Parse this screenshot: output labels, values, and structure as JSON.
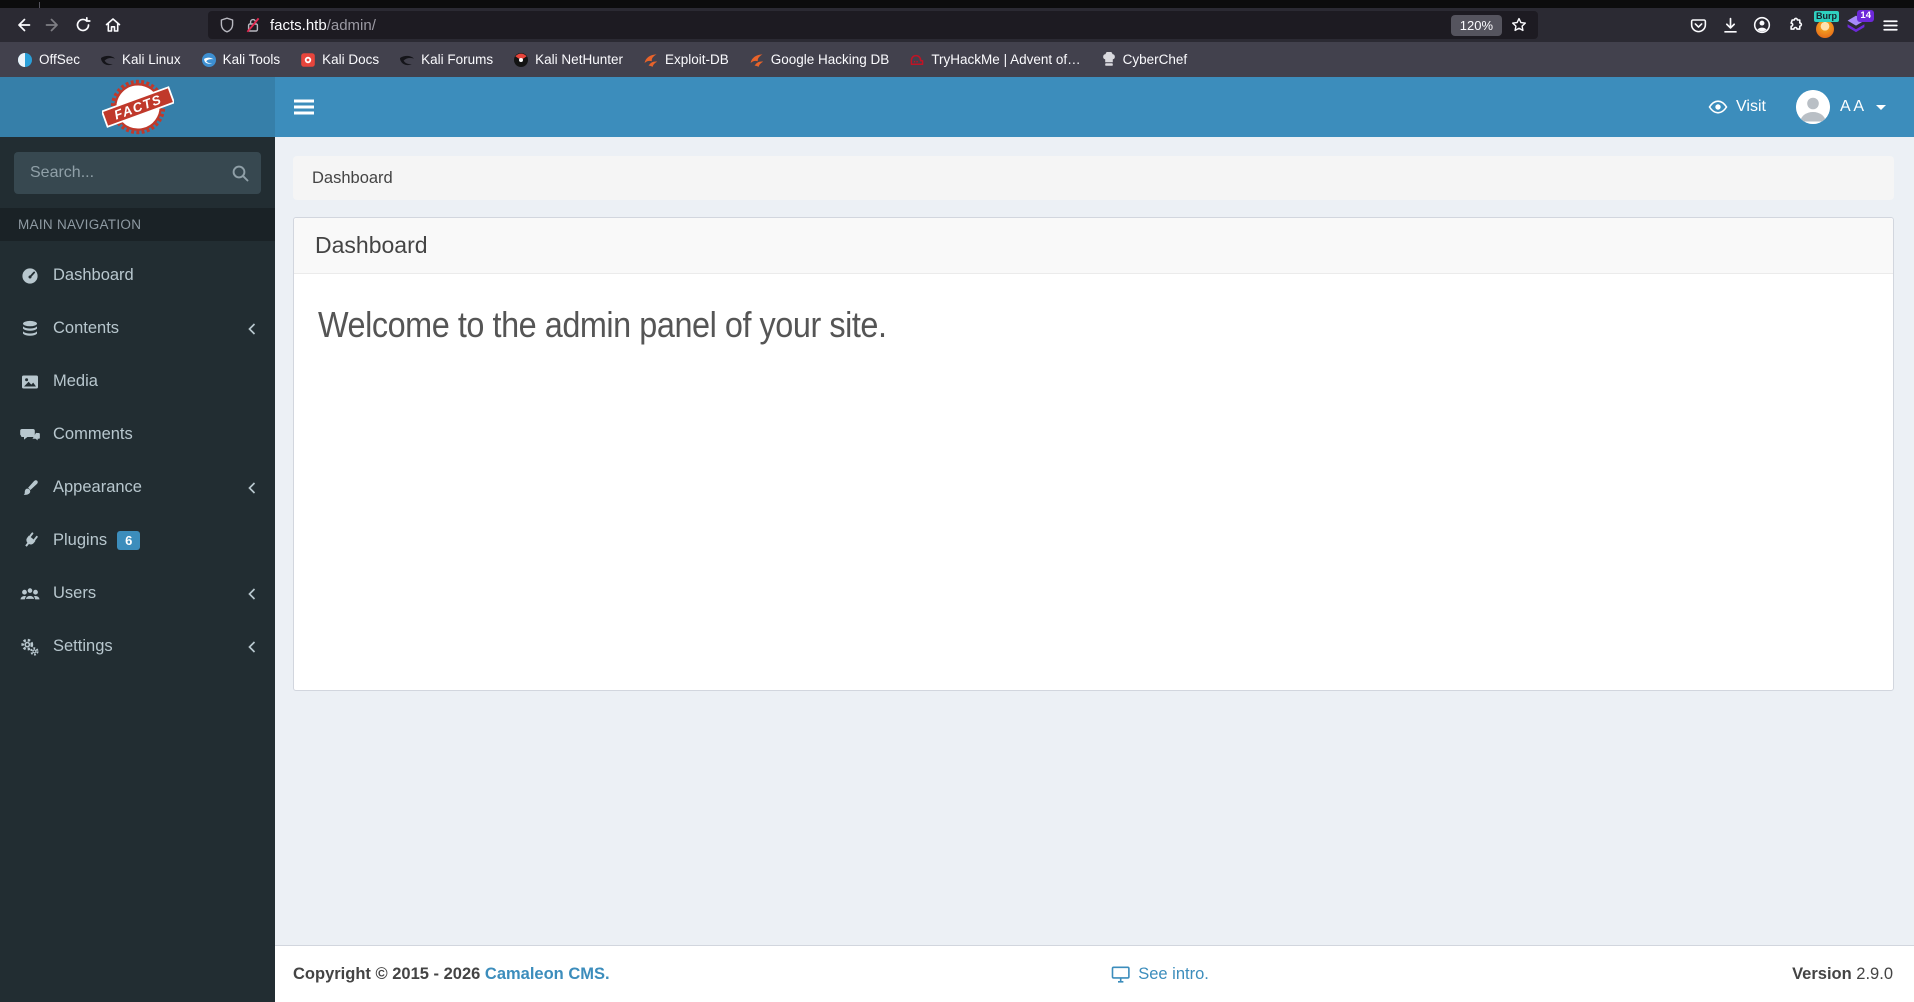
{
  "browser": {
    "url": {
      "host": "facts.htb",
      "path": "/admin/"
    },
    "zoom_badge": "120%",
    "proxy_label": "Burp",
    "extension_badge": "14",
    "bookmarks": [
      {
        "label": "OffSec"
      },
      {
        "label": "Kali Linux"
      },
      {
        "label": "Kali Tools"
      },
      {
        "label": "Kali Docs"
      },
      {
        "label": "Kali Forums"
      },
      {
        "label": "Kali NetHunter"
      },
      {
        "label": "Exploit-DB"
      },
      {
        "label": "Google Hacking DB"
      },
      {
        "label": "TryHackMe | Advent of…"
      },
      {
        "label": "CyberChef"
      }
    ]
  },
  "navbar": {
    "logo_text": "FACTS",
    "visit_label": "Visit",
    "user_initials": "A A"
  },
  "sidebar": {
    "search_placeholder": "Search...",
    "section_label": "MAIN NAVIGATION",
    "items": [
      {
        "label": "Dashboard"
      },
      {
        "label": "Contents",
        "chevron": true
      },
      {
        "label": "Media"
      },
      {
        "label": "Comments"
      },
      {
        "label": "Appearance",
        "chevron": true
      },
      {
        "label": "Plugins",
        "badge": "6"
      },
      {
        "label": "Users",
        "chevron": true
      },
      {
        "label": "Settings",
        "chevron": true
      }
    ]
  },
  "main": {
    "breadcrumb": "Dashboard",
    "panel_title": "Dashboard",
    "welcome_text": "Welcome to the admin panel of your site."
  },
  "footer": {
    "copyright": "Copyright © 2015 - 2026",
    "cms_link": "Camaleon CMS.",
    "see_intro": "See intro.",
    "version_label": "Version",
    "version_value": "2.9.0"
  },
  "icons": {
    "toolbar": [
      "back-icon",
      "forward-icon",
      "reload-icon",
      "home-icon",
      "shield-icon",
      "insecure-lock-icon",
      "star-icon",
      "pocket-icon",
      "downloads-icon",
      "account-icon",
      "extensions-puzzle-icon",
      "foxyproxy-icon",
      "layers-extension-icon",
      "menu-icon"
    ],
    "sidebar": [
      "dashboard-gauge-icon",
      "contents-database-icon",
      "media-image-icon",
      "comments-icon",
      "appearance-brush-icon",
      "plugins-plug-icon",
      "users-icon",
      "settings-gears-icon"
    ],
    "misc": [
      "search-icon",
      "eye-icon",
      "avatar",
      "caret-down-icon",
      "chevron-left-icon",
      "monitor-icon"
    ]
  },
  "colors": {
    "navbar_blue": "#3c8dbc",
    "logo_blue": "#367fa9",
    "sidebar_dark": "#222d32",
    "sidebar_header_dark": "#1a2226",
    "badge_blue": "#3c8dbc",
    "content_bg": "#ecf0f5",
    "link_blue": "#3c8dbc",
    "stamp_red": "#c0392b"
  }
}
